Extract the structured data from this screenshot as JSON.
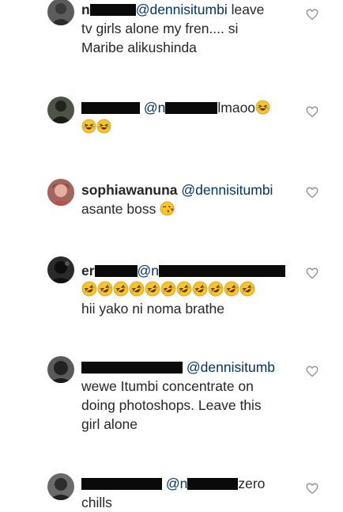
{
  "comments": [
    {
      "username_visible": "n",
      "mention": "@dennisitumbi",
      "text_line1": " leave",
      "text_line2": "tv girls alone my fren.... si",
      "text_line3": "Maribe alikushinda",
      "heart_icon": "heart-outline-icon"
    },
    {
      "mention_visible": "@n",
      "text": "lmaoo",
      "emoji": "grinning-squinting-face-emoji",
      "heart_icon": "heart-outline-icon"
    },
    {
      "username": "sophiawanuna",
      "mention": "@dennisitumbi",
      "text": "asante boss",
      "emoji": "face-blowing-kiss-emoji",
      "heart_icon": "heart-outline-icon"
    },
    {
      "username_visible": "er",
      "mention_visible": "@n",
      "emoji": "rolling-on-floor-laughing-emoji",
      "emoji_count": 11,
      "text": "hii yako ni noma brathe",
      "heart_icon": "heart-outline-icon"
    },
    {
      "mention": "@dennisitumb",
      "text_line1": "wewe Itumbi concentrate on",
      "text_line2": "doing photoshops. Leave this",
      "text_line3": "girl alone",
      "heart_icon": "heart-outline-icon"
    },
    {
      "mention_visible": "@n",
      "text": "zero",
      "text_line2": "chills",
      "heart_icon": "heart-outline-icon"
    }
  ],
  "colors": {
    "text": "#262626",
    "mention": "#003569",
    "redaction": "#0a0a0a",
    "heart_outline": "#8e8e8e"
  }
}
